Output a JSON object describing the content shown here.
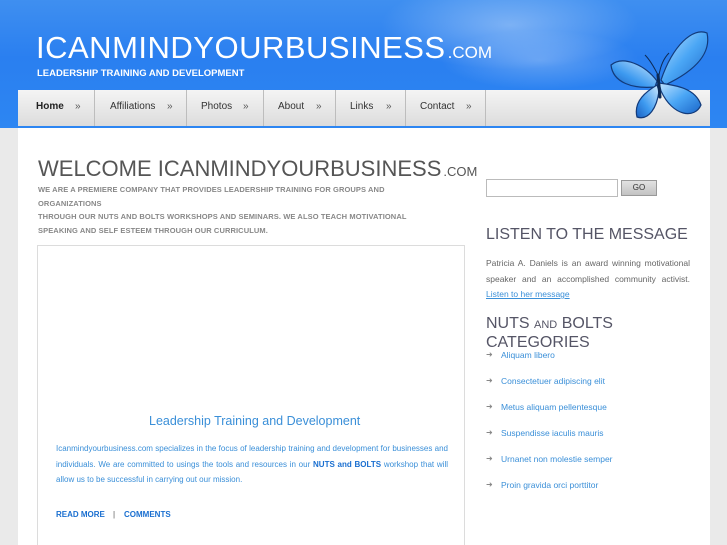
{
  "header": {
    "title_main": "ICANMINDYOURBUSINESS",
    "title_suffix": ".COM",
    "tagline": "LEADERSHIP TRAINING AND DEVELOPMENT"
  },
  "nav": {
    "items": [
      {
        "label": "Home",
        "arrow": "»",
        "active": true
      },
      {
        "label": "Affiliations",
        "arrow": "»"
      },
      {
        "label": "Photos",
        "arrow": "»"
      },
      {
        "label": "About",
        "arrow": "»"
      },
      {
        "label": "Links",
        "arrow": "»"
      },
      {
        "label": "Contact",
        "arrow": "»"
      }
    ]
  },
  "main": {
    "welcome_main": "WELCOME ICANMINDYOURBUSINESS",
    "welcome_suffix": ".COM",
    "intro_line1": "WE ARE A PREMIERE COMPANY THAT PROVIDES LEADERSHIP TRAINING FOR GROUPS AND ORGANIZATIONS",
    "intro_line2": "THROUGH OUR NUTS AND BOLTS WORKSHOPS AND SEMINARS. WE ALSO TEACH MOTIVATIONAL SPEAKING AND SELF ESTEEM THROUGH OUR CURRICULUM.",
    "post": {
      "title": "Leadership Training and Development",
      "body_part1": "Icanmindyourbusiness.com specializes in the focus of leadership training and development for businesses and individuals. We are committed to usings the tools and resources in our",
      "body_bold": "NUTS and BOLTS",
      "body_part2": "workshop that will allow us to be successful in carrying out our mission.",
      "read_more": "READ MORE",
      "separator": "|",
      "comments": "COMMENTS"
    }
  },
  "sidebar": {
    "search_placeholder": "",
    "go_label": "GO",
    "listen_heading": "LISTEN TO THE MESSAGE",
    "listen_text": "Patricia A. Daniels is an award winning motivational speaker and an accomplished community activist.",
    "listen_link": "Listen to her message",
    "cat_heading_part1": "NUTS",
    "cat_heading_and": "AND",
    "cat_heading_part2": "BOLTS CATEGORIES",
    "categories": [
      {
        "bullet": "➜",
        "label": "Aliquam libero"
      },
      {
        "bullet": "➜",
        "label": "Consectetuer adipiscing elit"
      },
      {
        "bullet": "➜",
        "label": "Metus aliquam pellentesque"
      },
      {
        "bullet": "➜",
        "label": "Suspendisse iaculis mauris"
      },
      {
        "bullet": "➜",
        "label": "Urnanet non molestie semper"
      },
      {
        "bullet": "➜",
        "label": "Proin gravida orci porttitor"
      }
    ]
  },
  "colors": {
    "header_blue": "#2d86f2",
    "link_blue": "#3a8fd8",
    "heading_gray": "#556677"
  }
}
